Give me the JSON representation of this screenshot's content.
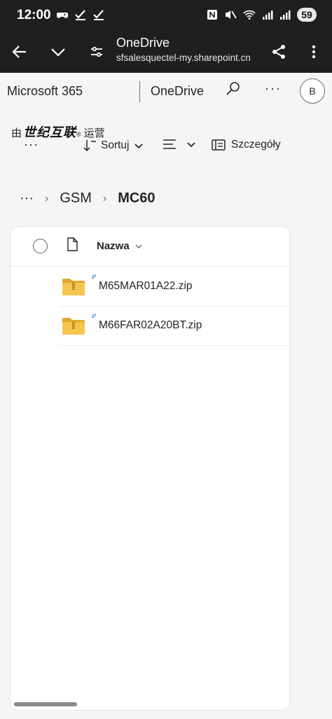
{
  "status_bar": {
    "time": "12:00",
    "battery": "59"
  },
  "app_bar": {
    "title": "OneDrive",
    "url": "sfsalesquectel-my.sharepoint.cn"
  },
  "top_nav": {
    "brand": "Microsoft 365",
    "app": "OneDrive",
    "more": "···",
    "avatar_initial": "B"
  },
  "operated_by": {
    "prefix": "由",
    "logo_text": "世纪互联",
    "registered": "®",
    "suffix": "运营"
  },
  "toolbar": {
    "more": "···",
    "sort_label": "Sortuj",
    "details_label": "Szczegóły"
  },
  "breadcrumb": {
    "more": "···",
    "items": [
      "GSM",
      "MC60"
    ]
  },
  "file_list": {
    "header_name": "Nazwa",
    "rows": [
      {
        "name": "M65MAR01A22.zip"
      },
      {
        "name": "M66FAR02A20BT.zip"
      }
    ]
  },
  "colors": {
    "chrome": "#1f1f1f",
    "background": "#f5f5f5",
    "folder": "#f2c04b",
    "spark": "#1d7fd6"
  }
}
